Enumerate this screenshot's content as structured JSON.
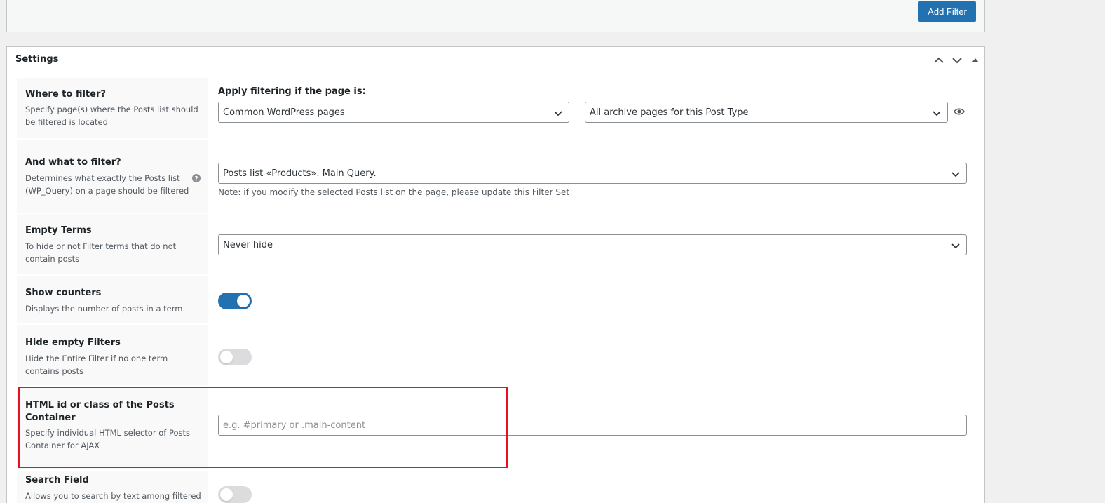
{
  "toolbar": {
    "add_filter_label": "Add Filter"
  },
  "settings": {
    "title": "Settings",
    "where_to_filter": {
      "title": "Where to filter?",
      "desc1": "Specify page(s) where the Posts list should",
      "desc2": "be filtered is located",
      "field_label": "Apply filtering if the page is:",
      "page_select": "Common WordPress pages",
      "archive_select": "All archive pages for this Post Type"
    },
    "what_to_filter": {
      "title": "And what to filter?",
      "desc1": "Determines what exactly the Posts list",
      "desc2": "(WP_Query) on a page should be filtered",
      "query_select": "Posts list «Products». Main Query.",
      "note": "Note: if you modify the selected Posts list on the page, please update this Filter Set"
    },
    "empty_terms": {
      "title": "Empty Terms",
      "desc1": "To hide or not Filter terms that do not",
      "desc2": "contain posts",
      "select": "Never hide"
    },
    "show_counters": {
      "title": "Show counters",
      "desc1": "Displays the number of posts in a term",
      "enabled": true
    },
    "hide_empty_filters": {
      "title": "Hide empty Filters",
      "desc1": "Hide the Entire Filter if no one term",
      "desc2": "contains posts",
      "enabled": false
    },
    "posts_container": {
      "title1": "HTML id or class of the Posts",
      "title2": "Container",
      "desc1": "Specify individual HTML selector of Posts",
      "desc2": "Container for AJAX",
      "value": "",
      "placeholder": "e.g. #primary or .main-content"
    },
    "search_field": {
      "title": "Search Field",
      "desc1": "Allows you to search by text among filtered",
      "enabled": false
    }
  },
  "colors": {
    "accent": "#2271b1",
    "highlight": "#e81123"
  }
}
